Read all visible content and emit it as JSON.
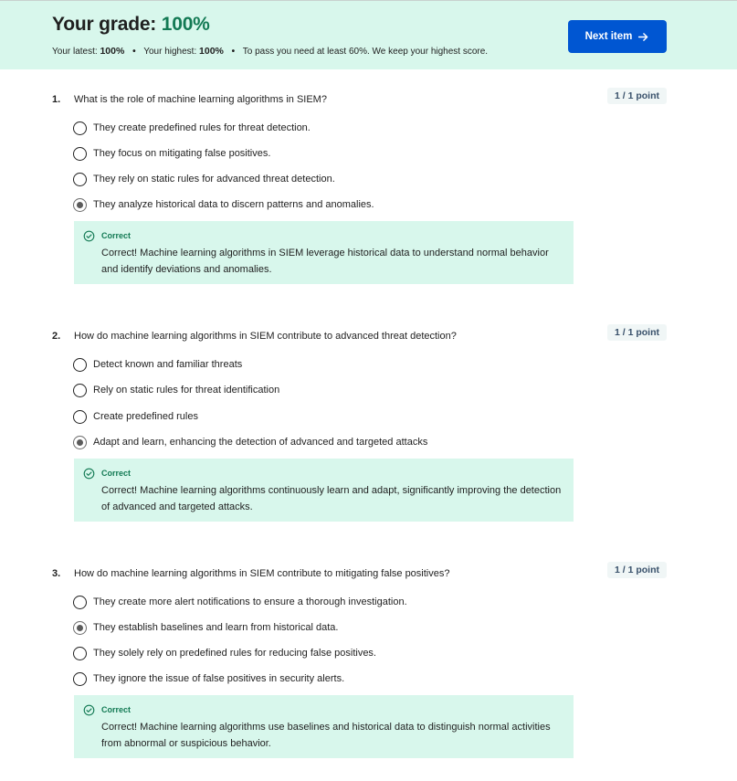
{
  "header": {
    "grade_label": "Your grade:",
    "grade_value": "100%",
    "latest_label": "Your latest:",
    "latest_value": "100%",
    "highest_label": "Your highest:",
    "highest_value": "100%",
    "pass_note": "To pass you need at least 60%. We keep your highest score.",
    "next_button": "Next item"
  },
  "colors": {
    "banner_bg": "#d8f7ec",
    "accent_green": "#137a54",
    "button_blue": "#0056d2"
  },
  "questions": [
    {
      "number": "1.",
      "text": "What is the role of machine learning algorithms in SIEM?",
      "points": "1 / 1 point",
      "options": [
        {
          "label": "They create predefined rules for threat detection.",
          "selected": false
        },
        {
          "label": "They focus on mitigating false positives.",
          "selected": false
        },
        {
          "label": "They rely on static rules for advanced threat detection.",
          "selected": false
        },
        {
          "label": "They analyze historical data to discern patterns and anomalies.",
          "selected": true
        }
      ],
      "feedback": {
        "title": "Correct",
        "text": "Correct! Machine learning algorithms in SIEM leverage historical data to understand normal behavior and identify deviations and anomalies."
      }
    },
    {
      "number": "2.",
      "text": "How do machine learning algorithms in SIEM contribute to advanced threat detection?",
      "points": "1 / 1 point",
      "options": [
        {
          "label": "Detect known and familiar threats",
          "selected": false
        },
        {
          "label": "Rely on static rules for threat identification",
          "selected": false
        },
        {
          "label": "Create predefined rules",
          "selected": false
        },
        {
          "label": "Adapt and learn, enhancing the detection of advanced and targeted attacks",
          "selected": true
        }
      ],
      "feedback": {
        "title": "Correct",
        "text": "Correct! Machine learning algorithms continuously learn and adapt, significantly improving the detection of advanced and targeted attacks."
      }
    },
    {
      "number": "3.",
      "text": "How do machine learning algorithms in SIEM contribute to mitigating false positives?",
      "points": "1 / 1 point",
      "options": [
        {
          "label": "They create more alert notifications to ensure a thorough investigation.",
          "selected": false
        },
        {
          "label": "They establish baselines and learn from historical data.",
          "selected": true
        },
        {
          "label": "They solely rely on predefined rules for reducing false positives.",
          "selected": false
        },
        {
          "label": "They ignore the issue of false positives in security alerts.",
          "selected": false
        }
      ],
      "feedback": {
        "title": "Correct",
        "text": "Correct! Machine learning algorithms use baselines and historical data to distinguish normal activities from abnormal or suspicious behavior."
      }
    }
  ]
}
